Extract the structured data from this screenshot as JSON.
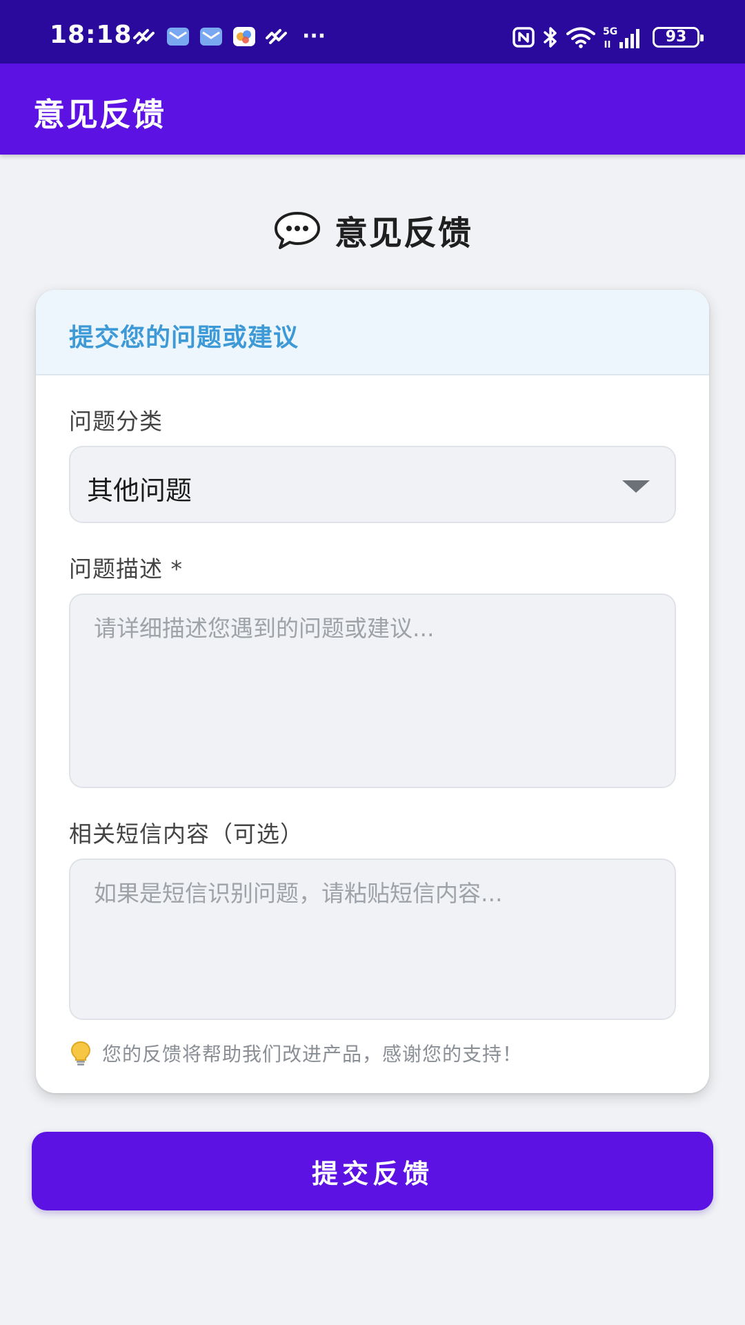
{
  "status_bar": {
    "time": "18:18",
    "more": "···",
    "battery": "93",
    "network": "5G",
    "icons": [
      "wave-icon",
      "message-icon",
      "message-icon",
      "colorful-app-icon",
      "wave-icon",
      "nfc-icon",
      "bluetooth-icon",
      "wifi-icon",
      "signal-icon",
      "battery-icon"
    ]
  },
  "app_bar": {
    "title": "意见反馈"
  },
  "heading": {
    "icon": "speech-bubble-icon",
    "text": "意见反馈"
  },
  "card": {
    "header_title": "提交您的问题或建议",
    "category": {
      "label": "问题分类",
      "selected": "其他问题"
    },
    "description": {
      "label": "问题描述 *",
      "placeholder": "请详细描述您遇到的问题或建议..."
    },
    "sms": {
      "label": "相关短信内容（可选）",
      "placeholder": "如果是短信识别问题，请粘贴短信内容..."
    },
    "hint": {
      "icon": "lightbulb-icon",
      "text": "您的反馈将帮助我们改进产品，感谢您的支持！"
    }
  },
  "submit": {
    "label": "提交反馈"
  },
  "colors": {
    "status_bar": "#2a0a9c",
    "primary": "#5b12e3",
    "header_text": "#3d9ad6",
    "background": "#f0f2f5"
  }
}
